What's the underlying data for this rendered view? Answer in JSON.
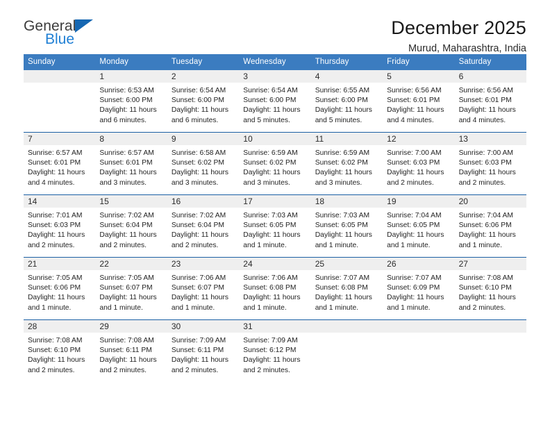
{
  "brand": {
    "name_top": "General",
    "name_bottom": "Blue",
    "triangle_color": "#1667b2",
    "blue_color": "#1f7fd4"
  },
  "header": {
    "title": "December 2025",
    "subtitle": "Murud, Maharashtra, India"
  },
  "theme": {
    "header_row_bg": "#3b7cc0",
    "week_divider": "#1b5fa4",
    "daynum_band_bg": "#efefef"
  },
  "weekdays": [
    "Sunday",
    "Monday",
    "Tuesday",
    "Wednesday",
    "Thursday",
    "Friday",
    "Saturday"
  ],
  "weeks": [
    [
      {
        "day": ""
      },
      {
        "day": "1",
        "sunrise": "Sunrise: 6:53 AM",
        "sunset": "Sunset: 6:00 PM",
        "daylight1": "Daylight: 11 hours",
        "daylight2": "and 6 minutes."
      },
      {
        "day": "2",
        "sunrise": "Sunrise: 6:54 AM",
        "sunset": "Sunset: 6:00 PM",
        "daylight1": "Daylight: 11 hours",
        "daylight2": "and 6 minutes."
      },
      {
        "day": "3",
        "sunrise": "Sunrise: 6:54 AM",
        "sunset": "Sunset: 6:00 PM",
        "daylight1": "Daylight: 11 hours",
        "daylight2": "and 5 minutes."
      },
      {
        "day": "4",
        "sunrise": "Sunrise: 6:55 AM",
        "sunset": "Sunset: 6:00 PM",
        "daylight1": "Daylight: 11 hours",
        "daylight2": "and 5 minutes."
      },
      {
        "day": "5",
        "sunrise": "Sunrise: 6:56 AM",
        "sunset": "Sunset: 6:01 PM",
        "daylight1": "Daylight: 11 hours",
        "daylight2": "and 4 minutes."
      },
      {
        "day": "6",
        "sunrise": "Sunrise: 6:56 AM",
        "sunset": "Sunset: 6:01 PM",
        "daylight1": "Daylight: 11 hours",
        "daylight2": "and 4 minutes."
      }
    ],
    [
      {
        "day": "7",
        "sunrise": "Sunrise: 6:57 AM",
        "sunset": "Sunset: 6:01 PM",
        "daylight1": "Daylight: 11 hours",
        "daylight2": "and 4 minutes."
      },
      {
        "day": "8",
        "sunrise": "Sunrise: 6:57 AM",
        "sunset": "Sunset: 6:01 PM",
        "daylight1": "Daylight: 11 hours",
        "daylight2": "and 3 minutes."
      },
      {
        "day": "9",
        "sunrise": "Sunrise: 6:58 AM",
        "sunset": "Sunset: 6:02 PM",
        "daylight1": "Daylight: 11 hours",
        "daylight2": "and 3 minutes."
      },
      {
        "day": "10",
        "sunrise": "Sunrise: 6:59 AM",
        "sunset": "Sunset: 6:02 PM",
        "daylight1": "Daylight: 11 hours",
        "daylight2": "and 3 minutes."
      },
      {
        "day": "11",
        "sunrise": "Sunrise: 6:59 AM",
        "sunset": "Sunset: 6:02 PM",
        "daylight1": "Daylight: 11 hours",
        "daylight2": "and 3 minutes."
      },
      {
        "day": "12",
        "sunrise": "Sunrise: 7:00 AM",
        "sunset": "Sunset: 6:03 PM",
        "daylight1": "Daylight: 11 hours",
        "daylight2": "and 2 minutes."
      },
      {
        "day": "13",
        "sunrise": "Sunrise: 7:00 AM",
        "sunset": "Sunset: 6:03 PM",
        "daylight1": "Daylight: 11 hours",
        "daylight2": "and 2 minutes."
      }
    ],
    [
      {
        "day": "14",
        "sunrise": "Sunrise: 7:01 AM",
        "sunset": "Sunset: 6:03 PM",
        "daylight1": "Daylight: 11 hours",
        "daylight2": "and 2 minutes."
      },
      {
        "day": "15",
        "sunrise": "Sunrise: 7:02 AM",
        "sunset": "Sunset: 6:04 PM",
        "daylight1": "Daylight: 11 hours",
        "daylight2": "and 2 minutes."
      },
      {
        "day": "16",
        "sunrise": "Sunrise: 7:02 AM",
        "sunset": "Sunset: 6:04 PM",
        "daylight1": "Daylight: 11 hours",
        "daylight2": "and 2 minutes."
      },
      {
        "day": "17",
        "sunrise": "Sunrise: 7:03 AM",
        "sunset": "Sunset: 6:05 PM",
        "daylight1": "Daylight: 11 hours",
        "daylight2": "and 1 minute."
      },
      {
        "day": "18",
        "sunrise": "Sunrise: 7:03 AM",
        "sunset": "Sunset: 6:05 PM",
        "daylight1": "Daylight: 11 hours",
        "daylight2": "and 1 minute."
      },
      {
        "day": "19",
        "sunrise": "Sunrise: 7:04 AM",
        "sunset": "Sunset: 6:05 PM",
        "daylight1": "Daylight: 11 hours",
        "daylight2": "and 1 minute."
      },
      {
        "day": "20",
        "sunrise": "Sunrise: 7:04 AM",
        "sunset": "Sunset: 6:06 PM",
        "daylight1": "Daylight: 11 hours",
        "daylight2": "and 1 minute."
      }
    ],
    [
      {
        "day": "21",
        "sunrise": "Sunrise: 7:05 AM",
        "sunset": "Sunset: 6:06 PM",
        "daylight1": "Daylight: 11 hours",
        "daylight2": "and 1 minute."
      },
      {
        "day": "22",
        "sunrise": "Sunrise: 7:05 AM",
        "sunset": "Sunset: 6:07 PM",
        "daylight1": "Daylight: 11 hours",
        "daylight2": "and 1 minute."
      },
      {
        "day": "23",
        "sunrise": "Sunrise: 7:06 AM",
        "sunset": "Sunset: 6:07 PM",
        "daylight1": "Daylight: 11 hours",
        "daylight2": "and 1 minute."
      },
      {
        "day": "24",
        "sunrise": "Sunrise: 7:06 AM",
        "sunset": "Sunset: 6:08 PM",
        "daylight1": "Daylight: 11 hours",
        "daylight2": "and 1 minute."
      },
      {
        "day": "25",
        "sunrise": "Sunrise: 7:07 AM",
        "sunset": "Sunset: 6:08 PM",
        "daylight1": "Daylight: 11 hours",
        "daylight2": "and 1 minute."
      },
      {
        "day": "26",
        "sunrise": "Sunrise: 7:07 AM",
        "sunset": "Sunset: 6:09 PM",
        "daylight1": "Daylight: 11 hours",
        "daylight2": "and 1 minute."
      },
      {
        "day": "27",
        "sunrise": "Sunrise: 7:08 AM",
        "sunset": "Sunset: 6:10 PM",
        "daylight1": "Daylight: 11 hours",
        "daylight2": "and 2 minutes."
      }
    ],
    [
      {
        "day": "28",
        "sunrise": "Sunrise: 7:08 AM",
        "sunset": "Sunset: 6:10 PM",
        "daylight1": "Daylight: 11 hours",
        "daylight2": "and 2 minutes."
      },
      {
        "day": "29",
        "sunrise": "Sunrise: 7:08 AM",
        "sunset": "Sunset: 6:11 PM",
        "daylight1": "Daylight: 11 hours",
        "daylight2": "and 2 minutes."
      },
      {
        "day": "30",
        "sunrise": "Sunrise: 7:09 AM",
        "sunset": "Sunset: 6:11 PM",
        "daylight1": "Daylight: 11 hours",
        "daylight2": "and 2 minutes."
      },
      {
        "day": "31",
        "sunrise": "Sunrise: 7:09 AM",
        "sunset": "Sunset: 6:12 PM",
        "daylight1": "Daylight: 11 hours",
        "daylight2": "and 2 minutes."
      },
      {
        "day": ""
      },
      {
        "day": ""
      },
      {
        "day": ""
      }
    ]
  ]
}
